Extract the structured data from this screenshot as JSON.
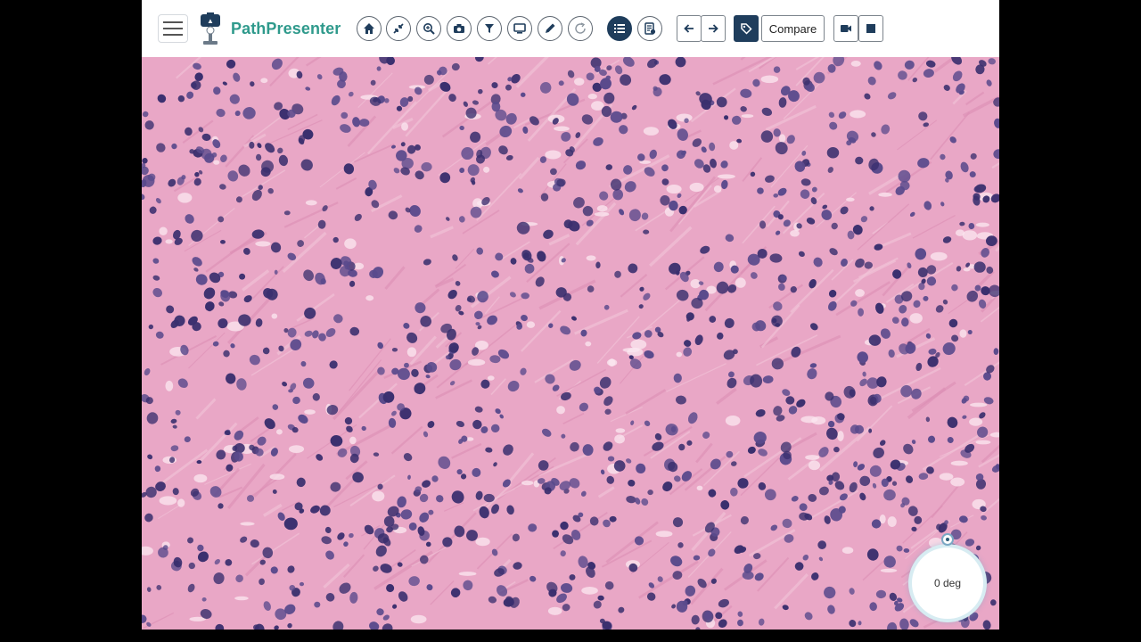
{
  "app": {
    "brand": "PathPresenter"
  },
  "toolbar": {
    "menu_icon": "hamburger-icon",
    "buttons": [
      {
        "id": "home",
        "icon": "home-icon"
      },
      {
        "id": "fit",
        "icon": "collapse-arrows-icon"
      },
      {
        "id": "zoom",
        "icon": "magnifier-zoom-icon"
      },
      {
        "id": "snapshot",
        "icon": "camera-icon"
      },
      {
        "id": "filter",
        "icon": "filter-icon"
      },
      {
        "id": "present",
        "icon": "monitor-icon"
      },
      {
        "id": "annotate",
        "icon": "pencil-icon"
      },
      {
        "id": "rotate",
        "icon": "refresh-icon"
      },
      {
        "id": "list",
        "icon": "list-icon"
      },
      {
        "id": "report",
        "icon": "document-icon"
      },
      {
        "id": "prev",
        "icon": "arrow-left-icon"
      },
      {
        "id": "next",
        "icon": "arrow-right-icon"
      },
      {
        "id": "tag",
        "icon": "tag-icon"
      },
      {
        "id": "record",
        "icon": "video-camera-icon"
      },
      {
        "id": "stop",
        "icon": "stop-icon"
      }
    ],
    "compare_label": "Compare"
  },
  "viewer": {
    "image_description": "H&E stained tissue slide",
    "palette": {
      "stroma": "#e9a7c6",
      "stroma_light": "#f2c4d8",
      "nucleus": "#3a2f6e",
      "nucleus_mid": "#5a4a8c",
      "halo": "#fbe8f0"
    }
  },
  "rotation": {
    "label": "0 deg"
  }
}
